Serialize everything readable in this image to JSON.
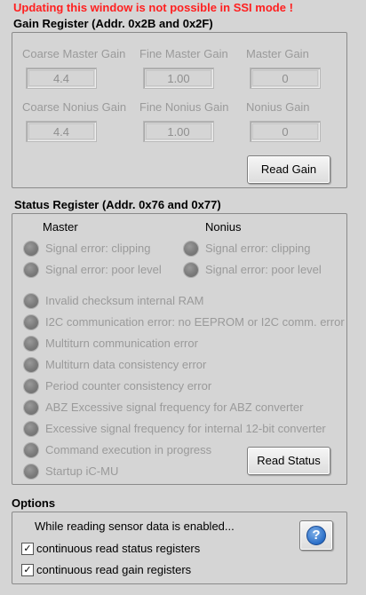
{
  "warning": "Updating this window is not possible in SSI mode !",
  "gain": {
    "title": "Gain Register (Addr. 0x2B and 0x2F)",
    "fields": [
      {
        "label": "Coarse Master Gain",
        "value": "4.4"
      },
      {
        "label": "Fine Master Gain",
        "value": "1.00"
      },
      {
        "label": "Master Gain",
        "value": "0"
      },
      {
        "label": "Coarse Nonius Gain",
        "value": "4.4"
      },
      {
        "label": "Fine Nonius Gain",
        "value": "1.00"
      },
      {
        "label": "Nonius Gain",
        "value": "0"
      }
    ],
    "read_button": "Read Gain"
  },
  "status": {
    "title": "Status Register (Addr. 0x76 and 0x77)",
    "master_head": "Master",
    "nonius_head": "Nonius",
    "master_items": [
      "Signal error: clipping",
      "Signal error: poor level"
    ],
    "nonius_items": [
      "Signal error: clipping",
      "Signal error: poor level"
    ],
    "items": [
      "Invalid checksum internal RAM",
      "I2C communication error: no EEPROM or I2C comm. error",
      "Multiturn communication error",
      "Multiturn data consistency error",
      "Period counter consistency error",
      "ABZ Excessive signal frequency for ABZ converter",
      "Excessive signal frequency for internal 12-bit converter",
      "Command execution in progress",
      "Startup iC-MU"
    ],
    "read_button": "Read Status"
  },
  "options": {
    "title": "Options",
    "description": "While reading sensor data is enabled...",
    "checkboxes": [
      {
        "label": "continuous read status registers",
        "checked": true
      },
      {
        "label": "continuous read gain registers",
        "checked": true
      }
    ],
    "help_glyph": "?"
  },
  "colors": {
    "background": "#d5d5d5",
    "warning": "#ff2020",
    "disabled_text": "#9a9a9a",
    "led_off": "#7b7b7b",
    "help_blue": "#2b6fc8"
  }
}
